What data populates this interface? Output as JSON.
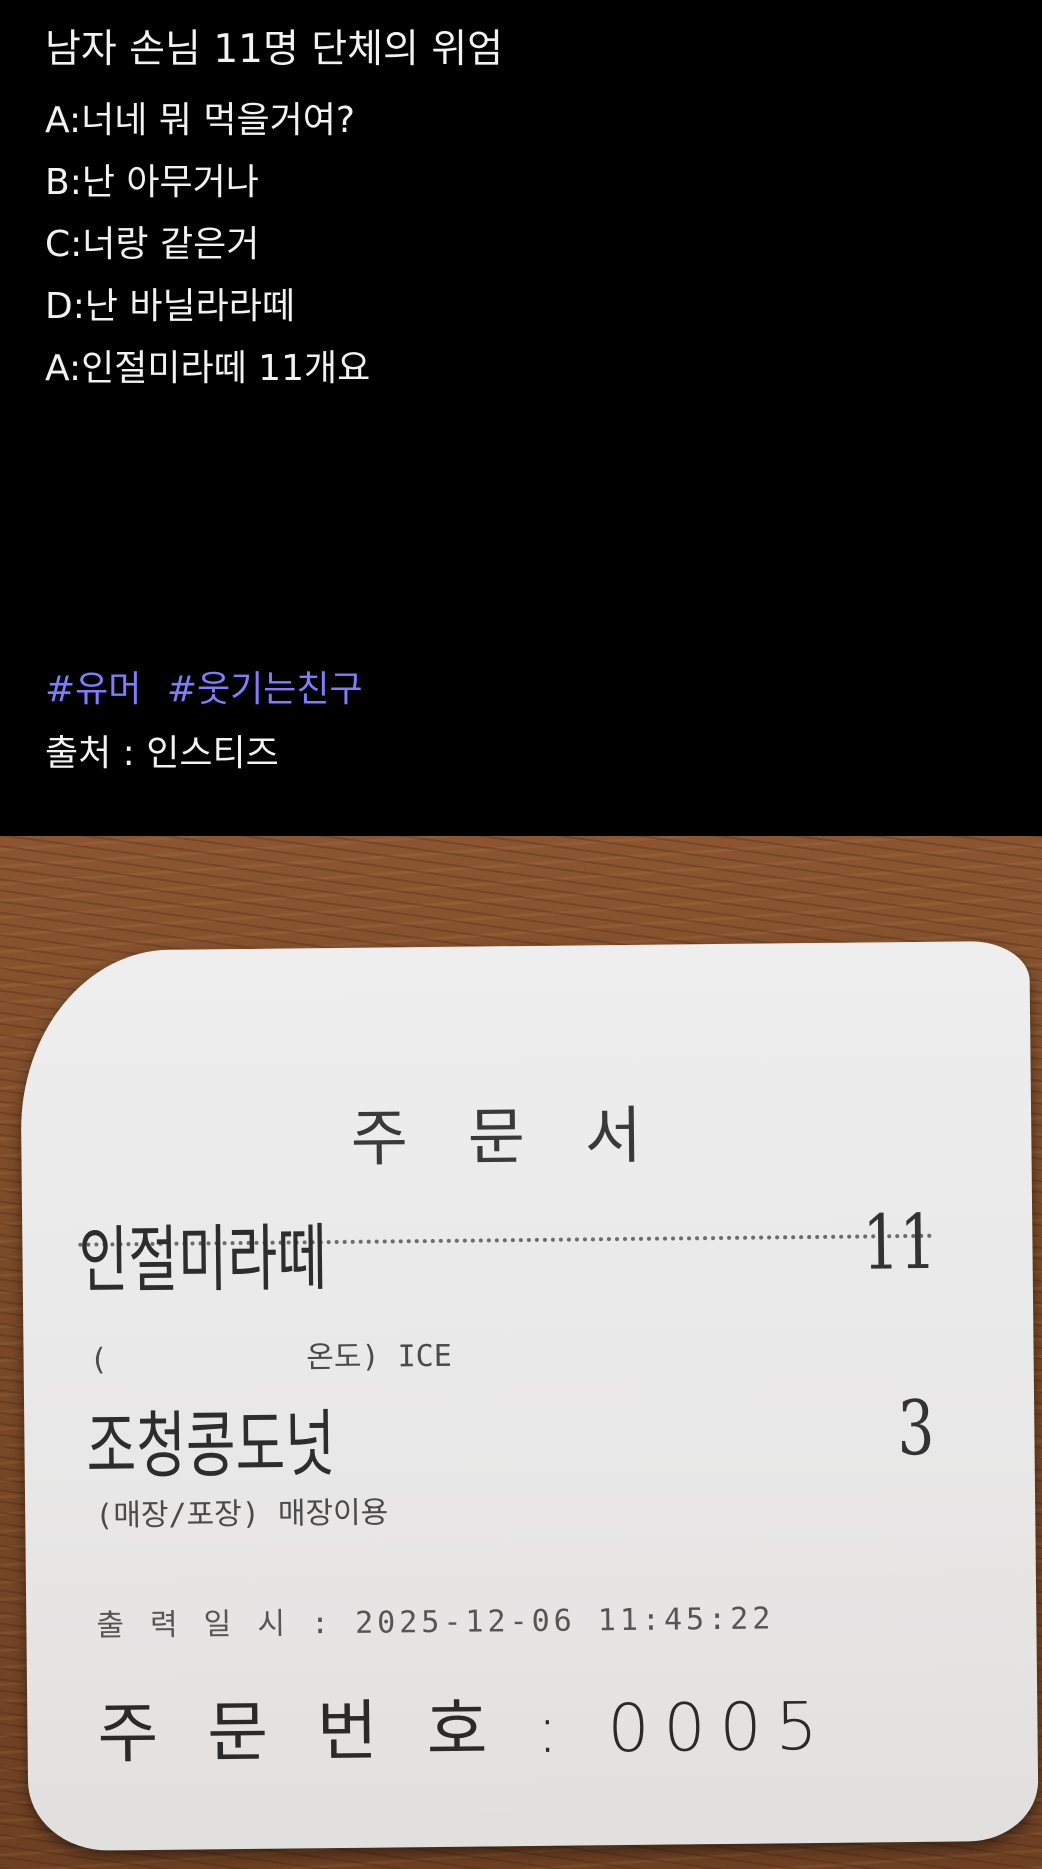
{
  "post": {
    "title": "남자 손님 11명 단체의 위엄",
    "dialog": [
      "A:너네 뭐 먹을거여?",
      "B:난 아무거나",
      "C:너랑 같은거",
      "D:난 바닐라라떼",
      "A:인절미라떼 11개요"
    ],
    "hashtags": [
      "#유머",
      "#웃기는친구"
    ],
    "source": "출처 : 인스티즈",
    "hashtag_color": "#7f7cff"
  },
  "receipt": {
    "heading": "주문서",
    "items": [
      {
        "name": "인절미라떼",
        "qty": "11",
        "option": "(           온도) ICE"
      },
      {
        "name": "조청콩도넛",
        "qty": "3",
        "option": "(매장/포장) 매장이용"
      }
    ],
    "printed_at": "출 력 일 시 : 2025-12-06 11:45:22",
    "order_number": "주 문 번 호 : 0005"
  }
}
